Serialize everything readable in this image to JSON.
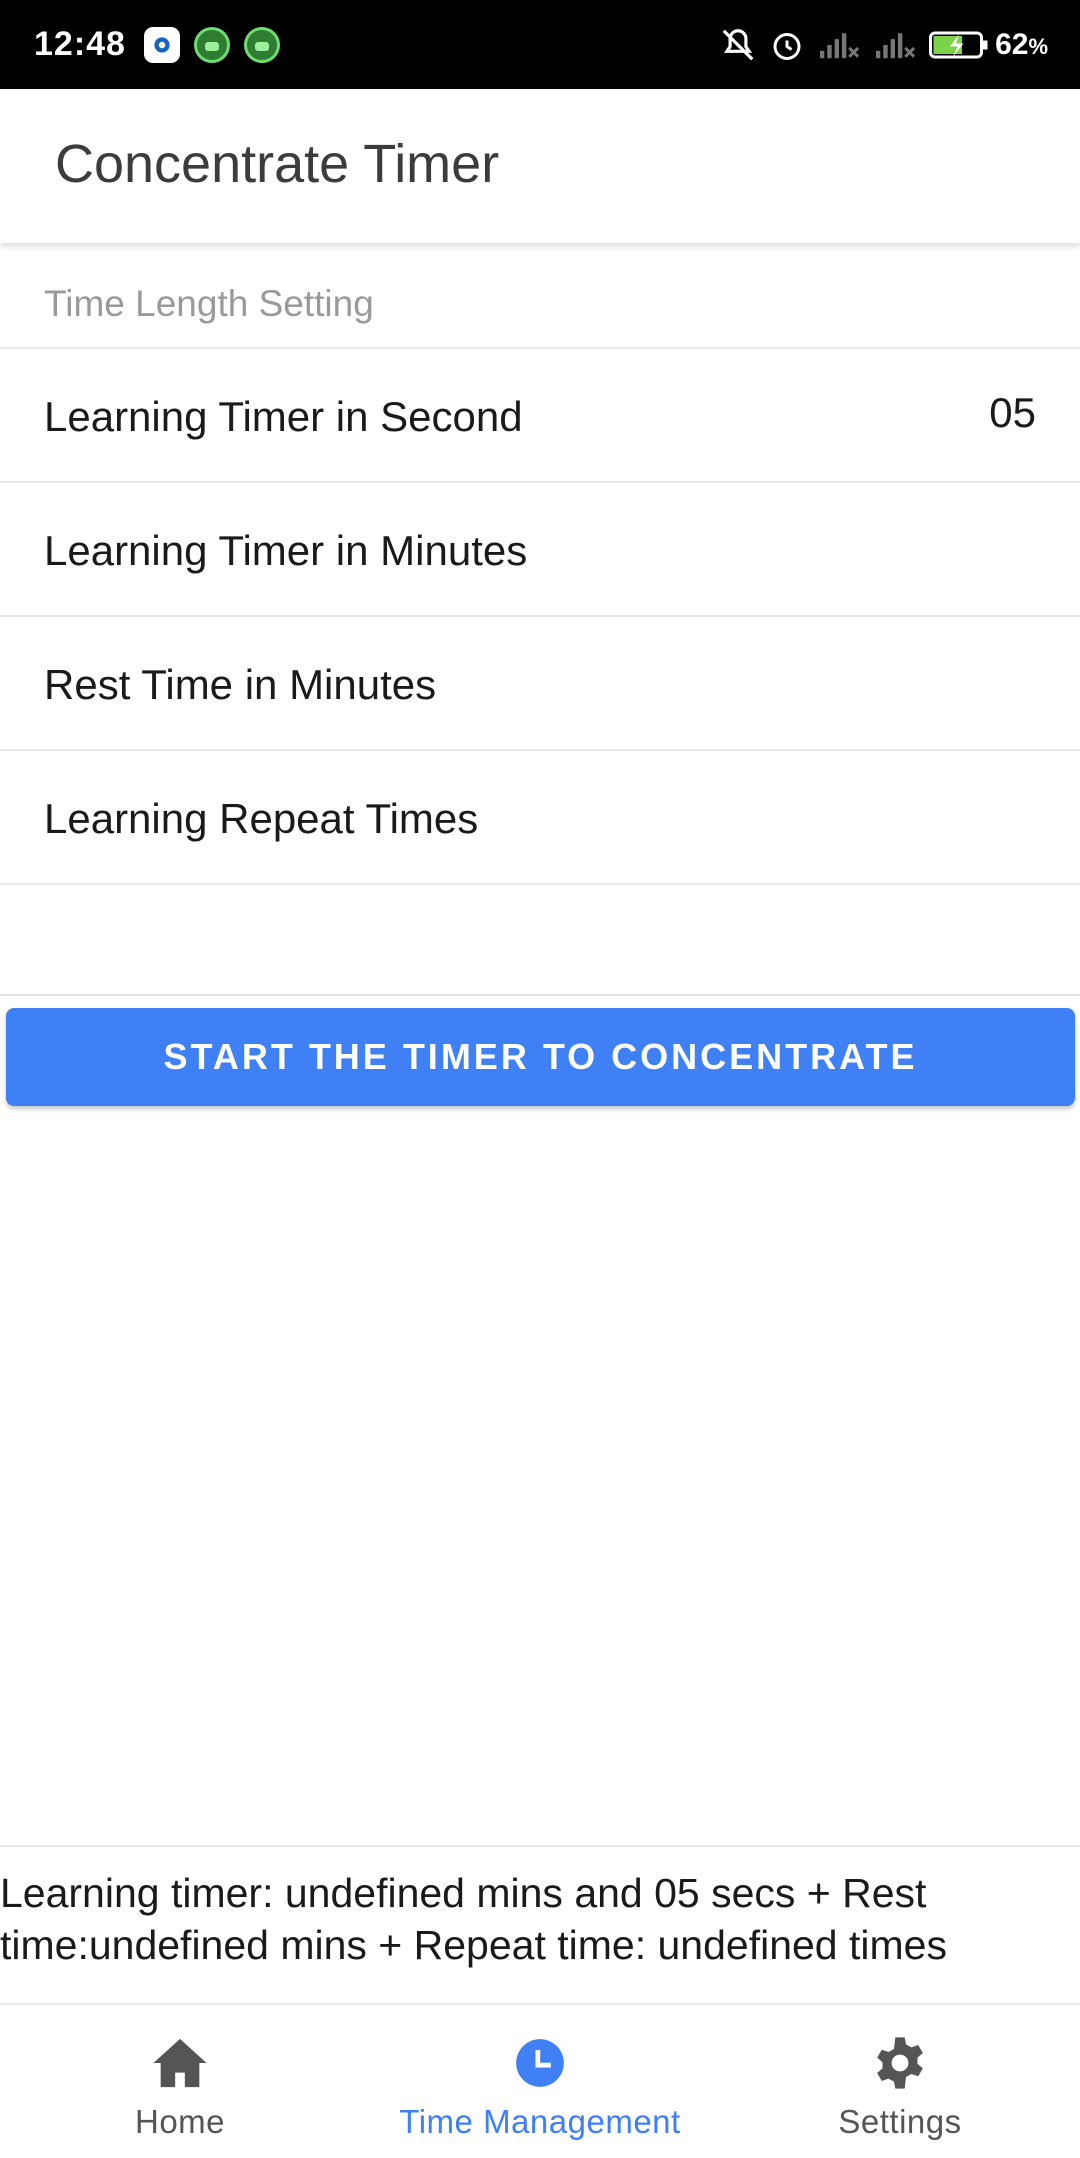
{
  "status_bar": {
    "time": "12:48",
    "battery_percent": "62",
    "battery_unit": "%",
    "icons": [
      "settings-app-icon",
      "android-app-icon",
      "android-app-icon",
      "silent-icon",
      "alarm-icon",
      "signal-icon",
      "signal-icon",
      "battery-charging-icon"
    ]
  },
  "app_bar": {
    "title": "Concentrate Timer"
  },
  "settings": {
    "section_header": "Time Length Setting",
    "rows": [
      {
        "label": "Learning Timer in Second",
        "value": "05"
      },
      {
        "label": "Learning Timer in Minutes",
        "value": ""
      },
      {
        "label": "Rest Time in Minutes",
        "value": ""
      },
      {
        "label": "Learning Repeat Times",
        "value": ""
      }
    ]
  },
  "start_button": {
    "label": "START THE TIMER TO CONCENTRATE"
  },
  "summary": {
    "text": "Learning timer: undefined mins and 05 secs + Rest time:undefined mins + Repeat time: undefined times"
  },
  "bottom_nav": {
    "items": [
      {
        "label": "Home",
        "icon": "home-icon",
        "active": false
      },
      {
        "label": "Time Management",
        "icon": "clock-icon",
        "active": true
      },
      {
        "label": "Settings",
        "icon": "gear-icon",
        "active": false
      }
    ]
  },
  "colors": {
    "accent": "#3f80f5",
    "divider": "#e6e6e6",
    "status_bar": "#000000"
  }
}
